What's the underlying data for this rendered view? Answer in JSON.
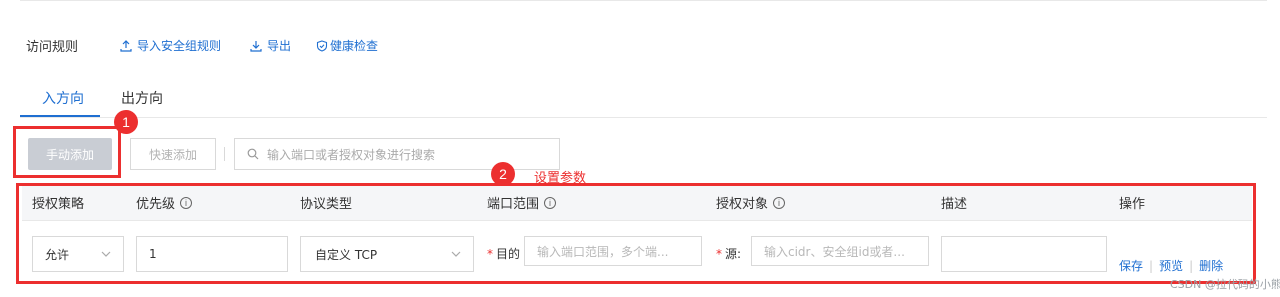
{
  "header": {
    "title": "访问规则",
    "import_label": "导入安全组规则",
    "export_label": "导出",
    "health_label": "健康检查"
  },
  "tabs": [
    {
      "label": "入方向",
      "active": true
    },
    {
      "label": "出方向",
      "active": false
    }
  ],
  "toolbar": {
    "manual_add_label": "手动添加",
    "quick_add_label": "快速添加",
    "search_placeholder": "输入端口或者授权对象进行搜索"
  },
  "annotations": {
    "badge1": "1",
    "badge2": "2",
    "label2": "设置参数"
  },
  "table": {
    "columns": [
      "授权策略",
      "优先级",
      "协议类型",
      "端口范围",
      "授权对象",
      "描述",
      "操作"
    ],
    "row": {
      "action": "允许",
      "priority": "1",
      "protocol": "自定义 TCP",
      "dest_label": "目的",
      "port_placeholder": "输入端口范围，多个端...",
      "source_label": "源:",
      "source_placeholder": "输入cidr、安全组id或者...",
      "description": "",
      "ops": [
        "保存",
        "预览",
        "删除"
      ]
    }
  },
  "watermark": "CSDN @拉代码的小熊",
  "colors": {
    "accent": "#1f6fd1",
    "annotation_red": "#ec2f2f",
    "disabled_button": "#c9cdd4"
  }
}
